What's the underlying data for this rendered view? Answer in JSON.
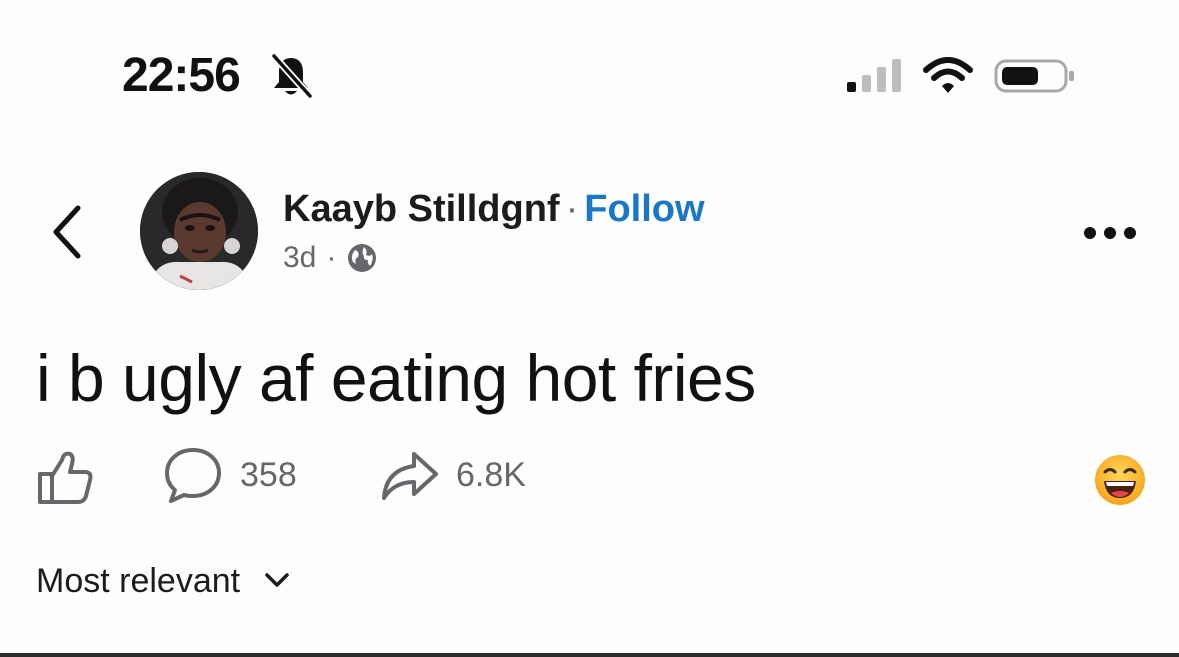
{
  "status_bar": {
    "time": "22:56",
    "icons": [
      "bell-slash-icon",
      "cellular-signal-icon",
      "wifi-icon",
      "battery-icon"
    ]
  },
  "post": {
    "author_name": "Kaayb Stilldgnf",
    "separator": "·",
    "follow_label": "Follow",
    "age": "3d",
    "meta_separator": "·",
    "audience_icon": "globe-icon",
    "text": "i b ugly af eating hot fries"
  },
  "actions": {
    "comment_count": "358",
    "share_count": "6.8K",
    "reaction": "grinning-face-emoji"
  },
  "comments": {
    "sort_label": "Most relevant"
  },
  "colors": {
    "follow_link": "#1877c9",
    "secondary_text": "#65676b",
    "primary_text": "#1c1c1e"
  }
}
